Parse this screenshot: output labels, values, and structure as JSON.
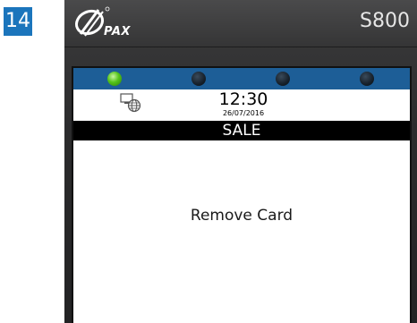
{
  "step_number": "14",
  "terminal": {
    "brand": "PAX",
    "model": "S800"
  },
  "status_leds": [
    {
      "state": "on",
      "color": "#55c41a"
    },
    {
      "state": "off",
      "color": "#16202a"
    },
    {
      "state": "off",
      "color": "#16202a"
    },
    {
      "state": "off",
      "color": "#16202a"
    }
  ],
  "status": {
    "network_icon": "network-globe-icon",
    "time": "12:30",
    "date": "26/07/2016"
  },
  "screen": {
    "title": "SALE",
    "message": "Remove Card"
  },
  "colors": {
    "step_badge": "#1b75bc",
    "led_bar": "#1d5e97",
    "title_bar": "#000000",
    "terminal_body": "#2c2c2d"
  }
}
